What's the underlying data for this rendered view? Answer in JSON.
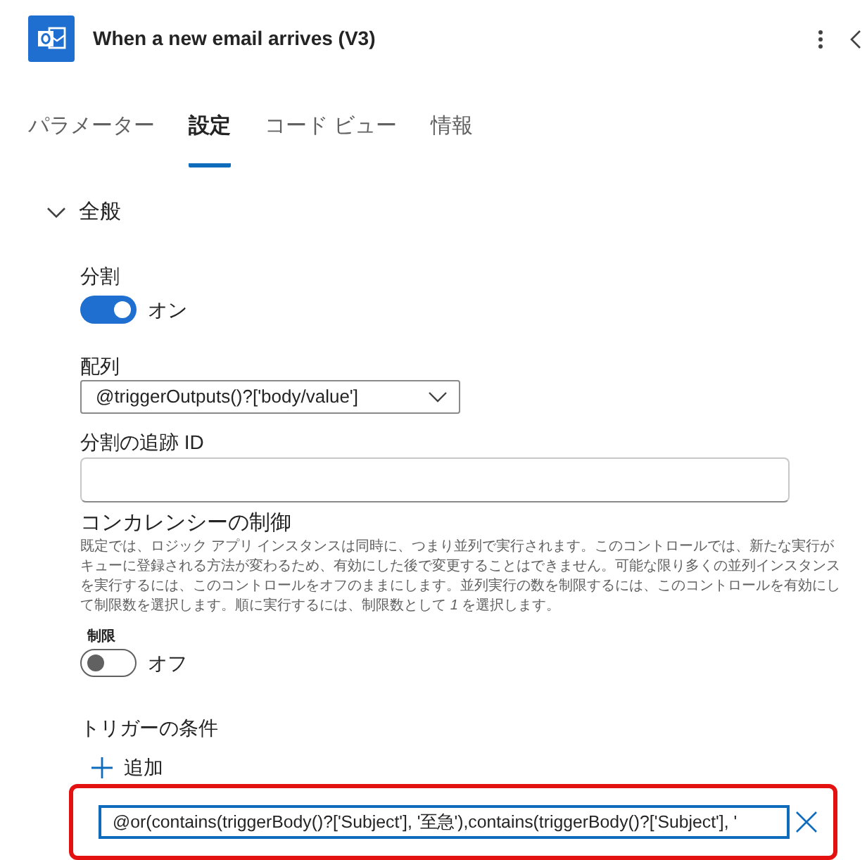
{
  "header": {
    "title": "When a new email arrives (V3)"
  },
  "tabs": [
    {
      "label": "パラメーター",
      "selected": false
    },
    {
      "label": "設定",
      "selected": true
    },
    {
      "label": "コード ビュー",
      "selected": false
    },
    {
      "label": "情報",
      "selected": false
    }
  ],
  "section": {
    "title": "全般",
    "expanded": true,
    "fields": [
      {
        "kind": "toggle",
        "label": "分割",
        "on": true,
        "state_text": "オン"
      },
      {
        "kind": "dropdown",
        "label": "配列",
        "value": "@triggerOutputs()?['body/value']"
      },
      {
        "kind": "text",
        "label": "分割の追跡 ID"
      },
      {
        "kind": "group",
        "title": "コンカレンシーの制御",
        "description": "既定では、ロジック アプリ インスタンスは同時に、つまり並列で実行されます。このコントロールでは、新たな実行がキューに登録される方法が変わるため、有効にした後で変更することはできません。可能な限り多くの並列インスタンスを実行するには、このコントロールをオフのままにします。並列実行の数を制限するには、このコントロールを有効にして制限数を選択します。順に実行するには、制限数として *1* を選択します。",
        "toggle": {
          "label": "制限",
          "on": false,
          "state_text": "オフ"
        }
      },
      {
        "kind": "conditions",
        "label": "トリガーの条件",
        "add_label": "追加",
        "conditions": [
          {
            "value": "@or(contains(triggerBody()?['Subject'], '至急'),contains(triggerBody()?['Subject'], '",
            "highlighted": true
          }
        ]
      }
    ]
  }
}
